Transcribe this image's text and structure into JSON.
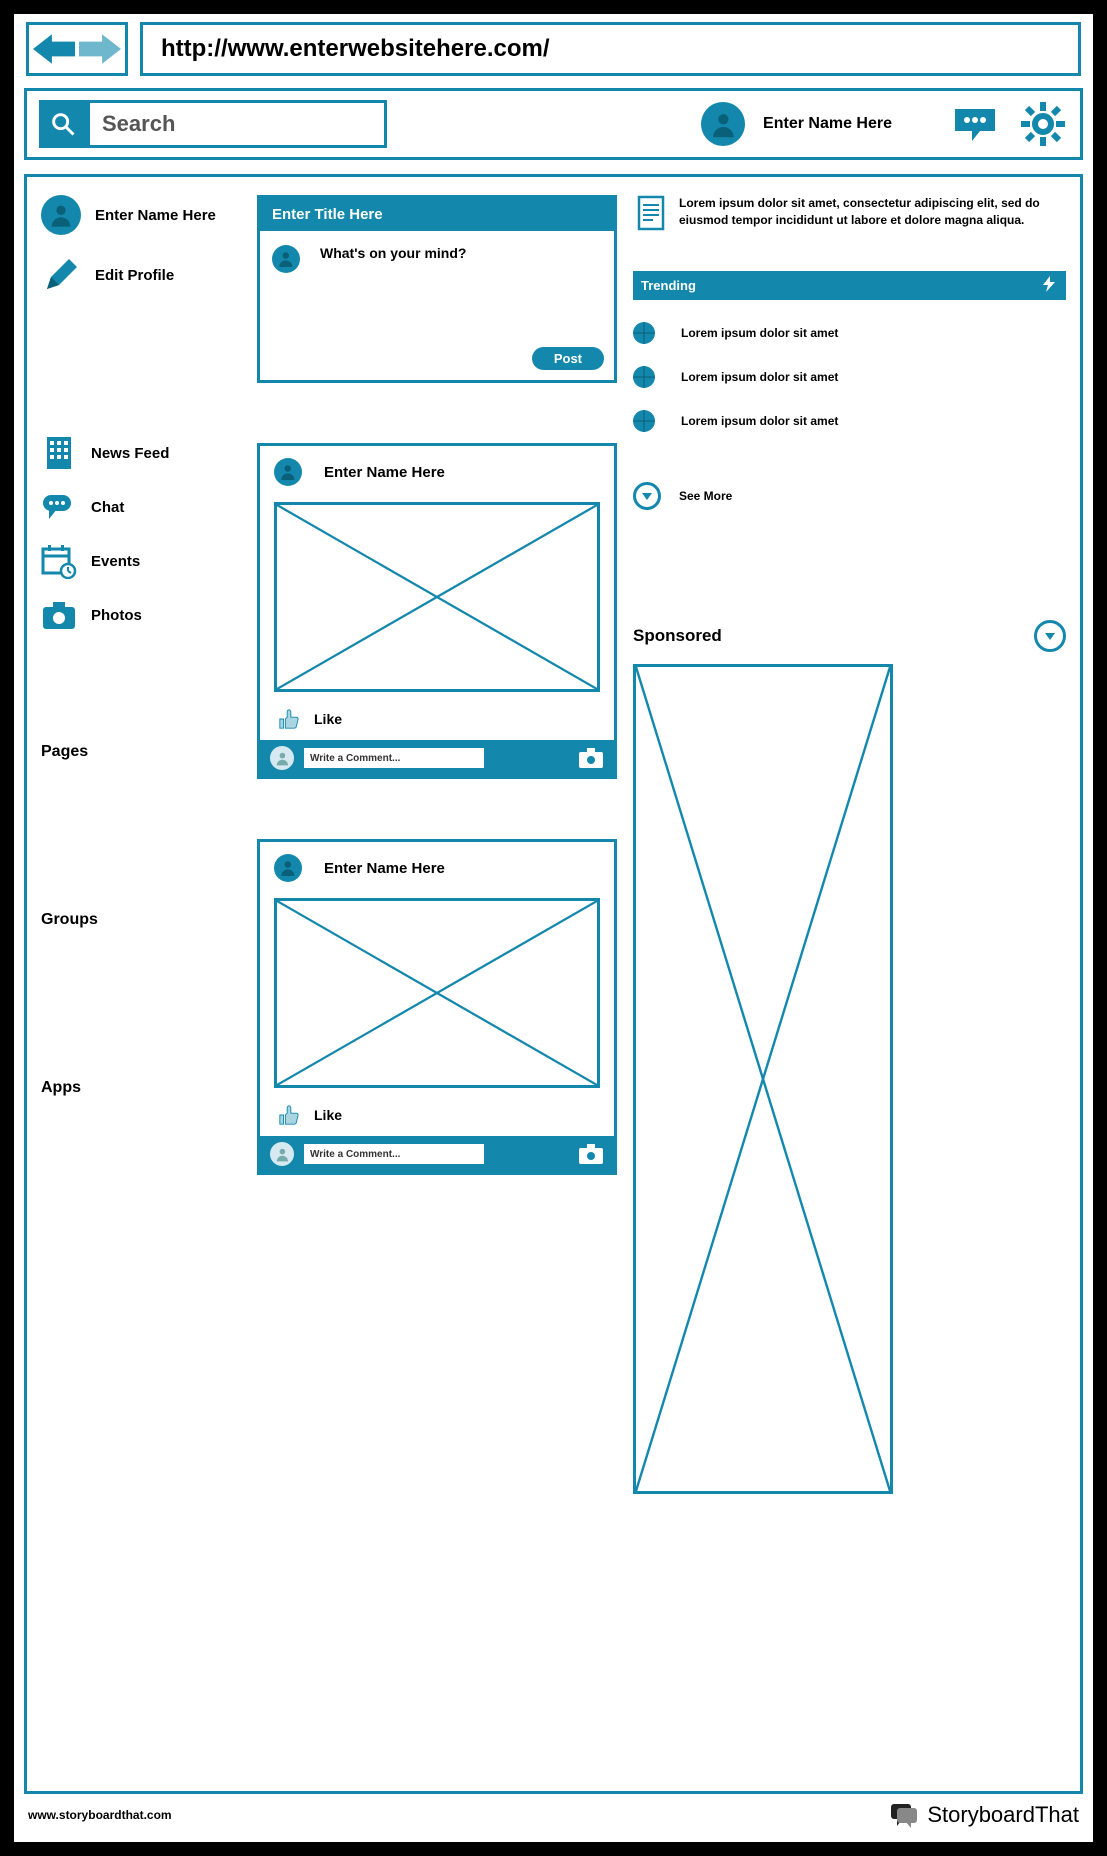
{
  "browser": {
    "url": "http://www.enterwebsitehere.com/"
  },
  "header": {
    "search_placeholder": "Search",
    "user_name": "Enter Name Here"
  },
  "sidebar": {
    "profile_name": "Enter Name Here",
    "edit_profile": "Edit Profile",
    "nav": [
      {
        "icon": "building-icon",
        "label": "News Feed"
      },
      {
        "icon": "chat-bubble-icon",
        "label": "Chat"
      },
      {
        "icon": "calendar-icon",
        "label": "Events"
      },
      {
        "icon": "camera-icon",
        "label": "Photos"
      }
    ],
    "sections": [
      "Pages",
      "Groups",
      "Apps"
    ]
  },
  "compose": {
    "title": "Enter Title Here",
    "prompt": "What's on your mind?",
    "post_button": "Post"
  },
  "feed": [
    {
      "author": "Enter Name Here",
      "like_label": "Like",
      "comment_placeholder": "Write a Comment..."
    },
    {
      "author": "Enter Name Here",
      "like_label": "Like",
      "comment_placeholder": "Write a Comment..."
    }
  ],
  "notice": {
    "text": "Lorem ipsum dolor sit amet, consectetur adipiscing elit, sed do eiusmod tempor incididunt ut labore et dolore magna aliqua."
  },
  "trending": {
    "title": "Trending",
    "items": [
      "Lorem ipsum dolor sit amet",
      "Lorem ipsum dolor sit amet",
      "Lorem ipsum dolor sit amet"
    ],
    "see_more": "See More"
  },
  "sponsored": {
    "title": "Sponsored"
  },
  "footer": {
    "url": "www.storyboardthat.com",
    "brand1": "Storyboard",
    "brand2": "That"
  },
  "colors": {
    "primary": "#1388ac"
  }
}
